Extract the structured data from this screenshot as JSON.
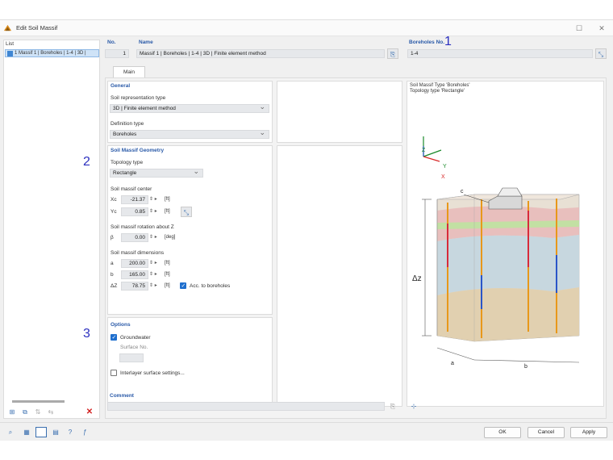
{
  "window": {
    "title": "Edit Soil Massif"
  },
  "list": {
    "header": "List",
    "items": [
      {
        "label": "1  Massif 1 | Boreholes | 1-4 | 3D |"
      }
    ]
  },
  "header": {
    "no_label": "No.",
    "no_value": "1",
    "name_label": "Name",
    "name_value": "Massif 1 | Boreholes | 1-4 | 3D | Finite element method",
    "boreholes_label": "Boreholes No.",
    "boreholes_value": "1-4"
  },
  "tabs": [
    {
      "label": "Main"
    }
  ],
  "general": {
    "title": "General",
    "rep_label": "Soil representation type",
    "rep_value": "3D | Finite element method",
    "def_label": "Definition type",
    "def_value": "Boreholes"
  },
  "geometry": {
    "title": "Soil Massif Geometry",
    "topology_label": "Topology type",
    "topology_value": "Rectangle",
    "center_label": "Soil massif center",
    "xc_label": "Xc",
    "xc_value": "-21.37",
    "xc_unit": "[ft]",
    "yc_label": "Yc",
    "yc_value": "0.85",
    "yc_unit": "[ft]",
    "rotation_label": "Soil massif rotation about Z",
    "beta_label": "β",
    "beta_value": "0.00",
    "beta_unit": "[deg]",
    "dims_label": "Soil massif dimensions",
    "a_label": "a",
    "a_value": "200.00",
    "a_unit": "[ft]",
    "b_label": "b",
    "b_value": "165.00",
    "b_unit": "[ft]",
    "dz_label": "ΔZ",
    "dz_value": "78.75",
    "dz_unit": "[ft]",
    "acc_label": "Acc. to boreholes"
  },
  "options": {
    "title": "Options",
    "groundwater_label": "Groundwater",
    "surface_label": "Surface No.",
    "interlayer_label": "Interlayer surface settings..."
  },
  "comment": {
    "label": "Comment",
    "value": ""
  },
  "preview": {
    "line1": "Soil Massif Type 'Boreholes'",
    "line2": "Topology type 'Rectangle'",
    "axis_z": "Z",
    "axis_y": "Y",
    "axis_x": "X",
    "label_c": "c",
    "label_dz": "Δz",
    "label_a": "a",
    "label_b": "b"
  },
  "markers": {
    "m1": "1",
    "m2": "2",
    "m3": "3"
  },
  "footer": {
    "ok": "OK",
    "cancel": "Cancel",
    "apply": "Apply"
  },
  "colors": {
    "accent": "#1f6fce",
    "section_header": "#2a5aa8",
    "delete": "#d21f1f"
  }
}
